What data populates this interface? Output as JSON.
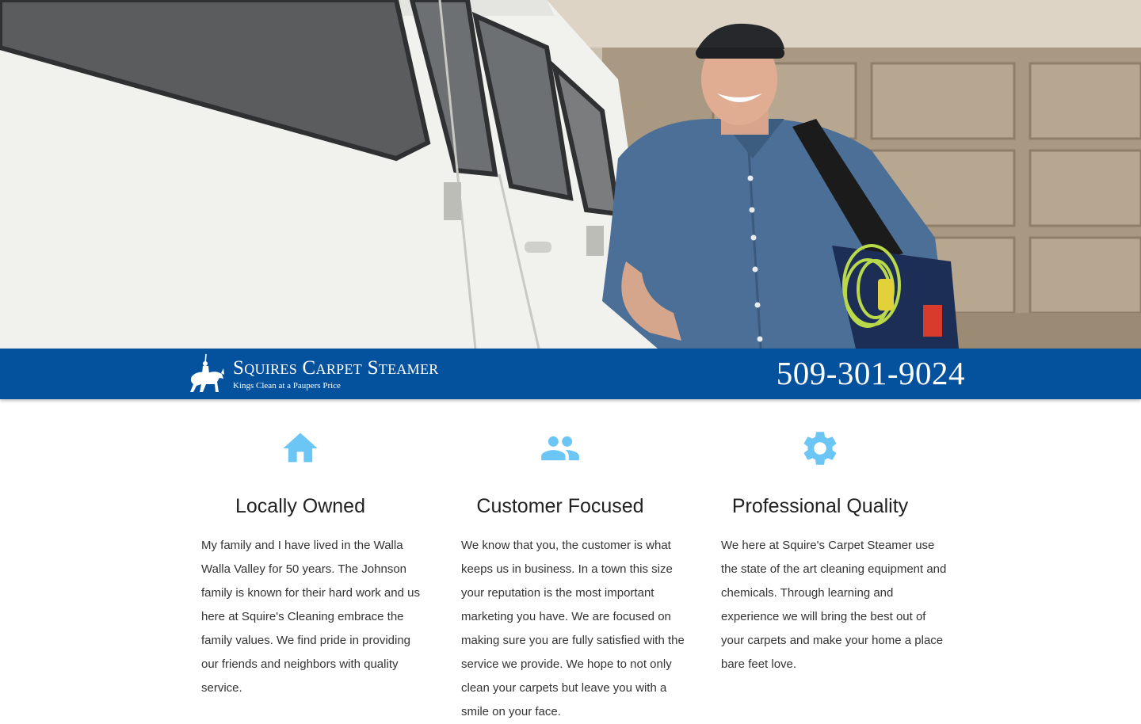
{
  "hero": {
    "image_description_icon": "hero-photo"
  },
  "header": {
    "brand_name": "Squires Carpet Steamer",
    "tagline": "Kings Clean at a Paupers Price",
    "phone": "509-301-9024",
    "logo_icon": "knight-on-horse-icon",
    "bar_color": "#04529e"
  },
  "features": [
    {
      "icon": "home-icon",
      "title": "Locally Owned",
      "text": "My family and I have lived in the Walla Walla Valley for 50 years. The Johnson family is known for their hard work and us here at Squire's Cleaning embrace the family values. We find pride in providing our friends and neighbors with quality service."
    },
    {
      "icon": "people-icon",
      "title": "Customer Focused",
      "text": "We know that you, the customer is what keeps us in business. In a town this size your reputation is the most important marketing you have. We are focused on making sure you are fully satisfied with the service we provide. We hope to not only clean your carpets but leave you with a smile on your face."
    },
    {
      "icon": "gear-icon",
      "title": "Professional Quality",
      "text": "We here at Squire's Carpet Steamer use the state of the art cleaning equipment and chemicals. Through learning and experience we will bring the best out of your carpets and make your home a place bare feet love."
    }
  ],
  "colors": {
    "icon_color": "#6cc6f5",
    "brand_blue": "#04529e"
  }
}
